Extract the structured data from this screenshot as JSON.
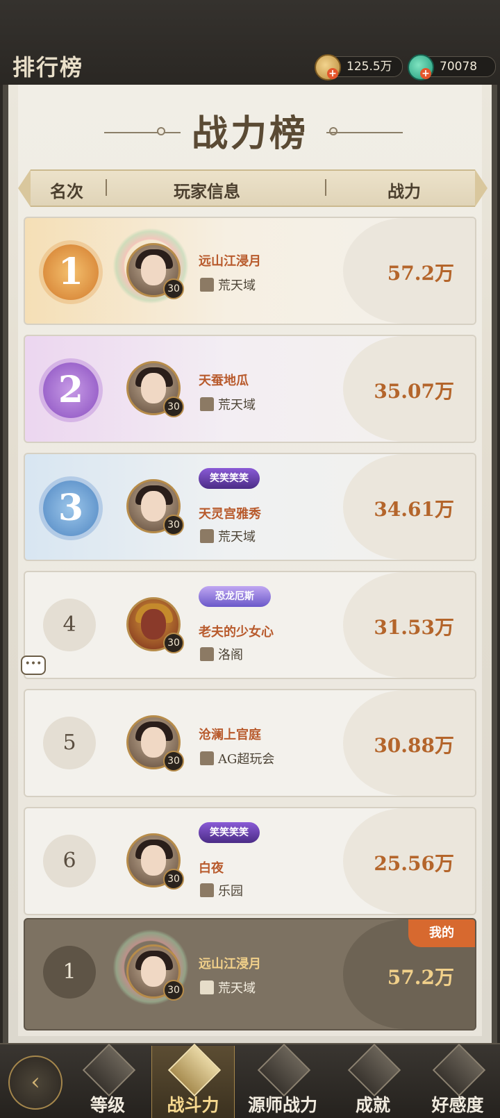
{
  "header": {
    "title": "排行榜",
    "currencies": [
      {
        "icon": "coin-icon",
        "value": "125.5万"
      },
      {
        "icon": "gem-icon",
        "value": "70078"
      }
    ]
  },
  "board": {
    "title": "战力榜",
    "columns": {
      "rank": "名次",
      "player": "玩家信息",
      "power": "战力"
    }
  },
  "rows": [
    {
      "rank": "1",
      "name": "远山江浸月",
      "guild": "荒天域",
      "level": "30",
      "power": "57.2万",
      "badge": ""
    },
    {
      "rank": "2",
      "name": "天蚕地瓜",
      "guild": "荒天域",
      "level": "30",
      "power": "35.07万",
      "badge": ""
    },
    {
      "rank": "3",
      "name": "天灵宫雅秀",
      "guild": "荒天域",
      "level": "30",
      "power": "34.61万",
      "badge": "笑笑笑笑"
    },
    {
      "rank": "4",
      "name": "老夫的少女心",
      "guild": "洛阁",
      "level": "30",
      "power": "31.53万",
      "badge": "恐龙厄斯"
    },
    {
      "rank": "5",
      "name": "沧澜上官庭",
      "guild": "AG超玩会",
      "level": "30",
      "power": "30.88万",
      "badge": ""
    },
    {
      "rank": "6",
      "name": "白夜",
      "guild": "乐园",
      "level": "30",
      "power": "25.56万",
      "badge": "笑笑笑笑"
    }
  ],
  "me": {
    "tag": "我的",
    "rank": "1",
    "name": "远山江浸月",
    "guild": "荒天域",
    "level": "30",
    "power": "57.2万"
  },
  "chat": {
    "icon": "chat-bubble-icon",
    "text": "•••"
  },
  "tabs": [
    {
      "label": "等级"
    },
    {
      "label": "战斗力"
    },
    {
      "label": "源师战力"
    },
    {
      "label": "成就"
    },
    {
      "label": "好感度"
    }
  ],
  "colors": {
    "accent": "#b4652b",
    "name": "#b85a2c",
    "gold": "#d8a04a",
    "purple": "#a86ad0",
    "blue": "#4f8fcf"
  }
}
